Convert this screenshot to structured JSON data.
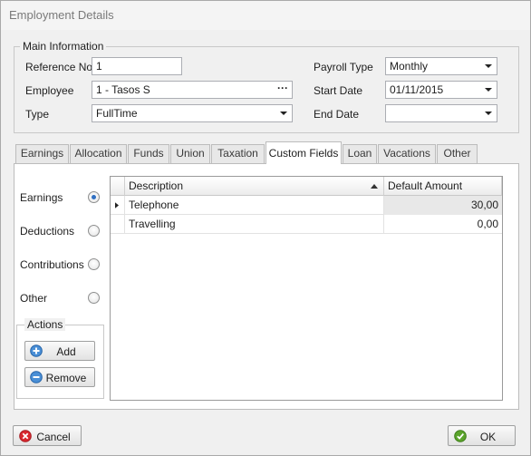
{
  "window": {
    "title": "Employment Details"
  },
  "main_info": {
    "legend": "Main Information",
    "reference_no_label": "Reference No",
    "reference_no_value": "1",
    "employee_label": "Employee",
    "employee_value": "1 - Tasos S",
    "type_label": "Type",
    "type_value": "FullTime",
    "payroll_type_label": "Payroll Type",
    "payroll_type_value": "Monthly",
    "start_date_label": "Start Date",
    "start_date_value": "01/11/2015",
    "end_date_label": "End Date",
    "end_date_value": ""
  },
  "tabs": [
    {
      "label": "Earnings"
    },
    {
      "label": "Allocation"
    },
    {
      "label": "Funds"
    },
    {
      "label": "Union"
    },
    {
      "label": "Taxation"
    },
    {
      "label": "Custom Fields",
      "active": true
    },
    {
      "label": "Loan"
    },
    {
      "label": "Vacations"
    },
    {
      "label": "Other"
    }
  ],
  "categories": {
    "options": [
      {
        "label": "Earnings",
        "checked": true
      },
      {
        "label": "Deductions",
        "checked": false
      },
      {
        "label": "Contributions",
        "checked": false
      },
      {
        "label": "Other",
        "checked": false
      }
    ]
  },
  "actions": {
    "legend": "Actions",
    "add_label": "Add",
    "remove_label": "Remove"
  },
  "grid": {
    "columns": [
      "Description",
      "Default Amount"
    ],
    "rows": [
      {
        "description": "Telephone",
        "amount": "30,00",
        "current": true
      },
      {
        "description": "Travelling",
        "amount": "0,00",
        "current": false
      }
    ]
  },
  "footer": {
    "cancel_label": "Cancel",
    "ok_label": "OK"
  },
  "colors": {
    "accent_blue": "#2f6fc2",
    "selected_row": "#e8e8e8",
    "cancel_red": "#d9272e",
    "ok_green": "#5aa32b"
  },
  "icons": {
    "dropdown": "chevron-down-icon",
    "browse": "ellipsis-icon",
    "sort": "sort-ascending-icon",
    "row_indicator": "current-row-icon",
    "add": "plus-icon",
    "remove": "minus-icon",
    "cancel": "cancel-icon",
    "ok": "check-icon"
  }
}
